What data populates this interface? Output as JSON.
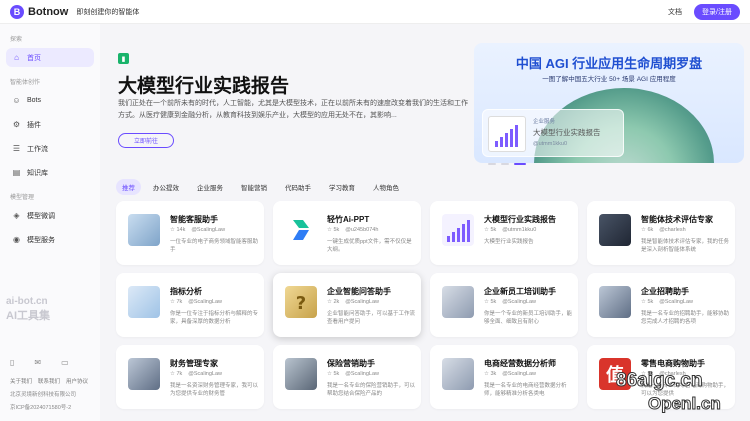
{
  "topbar": {
    "logo_mark": "B",
    "logo_text": "Botnow",
    "tagline": "即刻创建你的智能体",
    "doc_link": "文档",
    "login_label": "登录/注册"
  },
  "sidebar": {
    "groups": [
      {
        "label": "探索",
        "items": [
          {
            "label": "首页",
            "icon": "home-icon"
          }
        ]
      },
      {
        "label": "智能体创作",
        "items": [
          {
            "label": "Bots",
            "icon": "bot-icon"
          },
          {
            "label": "插件",
            "icon": "plugin-icon"
          },
          {
            "label": "工作流",
            "icon": "workflow-icon"
          },
          {
            "label": "知识库",
            "icon": "knowledge-icon"
          }
        ]
      },
      {
        "label": "模型管理",
        "items": [
          {
            "label": "模型微调",
            "icon": "tune-icon"
          },
          {
            "label": "模型服务",
            "icon": "model-service-icon"
          }
        ]
      }
    ],
    "watermark_line1": "ai-bot.cn",
    "watermark_line2": "AI工具集",
    "footer_links": [
      "关于我们",
      "联系我们",
      "用户协议"
    ],
    "copyright": "北京灵境新创科技有限公司",
    "icp": "京ICP备2024071580号-2"
  },
  "banner": {
    "title": "大模型行业实践报告",
    "description": "我们正处在一个前所未有的时代，人工智能，尤其是大模型技术，正在以前所未有的速度改变着我们的生活和工作方式。从医疗健康到金融分析，从教育科技到娱乐产业，大模型的应用无处不在，其影响...",
    "button_label": "立即前往",
    "promo": {
      "title": "中国 AGI 行业应用生命周期罗盘",
      "subtitle": "一图了解中国五大行业 50+ 场景 AGI 应用程度",
      "card_tag": "企业服务",
      "card_title": "大模型行业实践报告",
      "card_user": "@utmm1kku0"
    }
  },
  "tabs": [
    "推荐",
    "办公提效",
    "企业服务",
    "智能营销",
    "代码助手",
    "学习教育",
    "人物角色"
  ],
  "cards": [
    {
      "name": "智能客服助手",
      "stars": "14k",
      "author": "@ScalingLaw",
      "desc": "一位专业的电子商务领域智能客服助手",
      "thumb": "t-blue"
    },
    {
      "name": "轻竹Ai-PPT",
      "stars": "5k",
      "author": "@u245b074h",
      "desc": "一键生成优质ppt文件，需不仅仅是大纲。",
      "thumb": "t-logo"
    },
    {
      "name": "大模型行业实践报告",
      "stars": "5k",
      "author": "@utmm1kku0",
      "desc": "大模型行业实践报告",
      "thumb": "t-chart"
    },
    {
      "name": "智能体技术评估专家",
      "stars": "6k",
      "author": "@charlesh",
      "desc": "我是智能体技术评估专家，我的任务是深入剖析智能体系统",
      "thumb": "t-dark"
    },
    {
      "name": "指标分析",
      "stars": "7k",
      "author": "@ScalingLaw",
      "desc": "你是一位专注于指标分析与解释的专家，具备深厚的数据分析",
      "thumb": "t-sky"
    },
    {
      "name": "企业智能问答助手",
      "stars": "2k",
      "author": "@ScalingLaw",
      "desc": "企业智能问答助手，可以基于工作流查看用户提问",
      "thumb": "t-gold"
    },
    {
      "name": "企业新员工培训助手",
      "stars": "5k",
      "author": "@ScalingLaw",
      "desc": "你是一个专业的新员工培训助手，能够全面、细致且有耐心",
      "thumb": "t-office"
    },
    {
      "name": "企业招聘助手",
      "stars": "5k",
      "author": "@ScalingLaw",
      "desc": "我是一名专业的招聘助手，能够协助您完成人才招聘的各项",
      "thumb": "t-desk"
    },
    {
      "name": "财务管理专家",
      "stars": "7k",
      "author": "@ScalingLaw",
      "desc": "我是一名资深财务管理专家，我可以为您提供专业的财务管",
      "thumb": "t-desk"
    },
    {
      "name": "保险营销助手",
      "stars": "5k",
      "author": "@ScalingLaw",
      "desc": "我是一名专业的保险营销助手，可以帮助您结合保险产品的",
      "thumb": "t-person"
    },
    {
      "name": "电商经营数据分析师",
      "stars": "3k",
      "author": "@ScalingLaw",
      "desc": "我是一名专业的电商经营数据分析师，能够精准分析各类电",
      "thumb": "t-office"
    },
    {
      "name": "零售电商购物助手",
      "stars": "5k",
      "author": "@charlesh",
      "desc": "我是一名专业的零售电商购物助手，可以为您提供",
      "thumb": "t-red",
      "thumb_char": "值"
    }
  ],
  "watermarks": {
    "right1": "86aigc.cn",
    "right2": "Openl.cn"
  }
}
